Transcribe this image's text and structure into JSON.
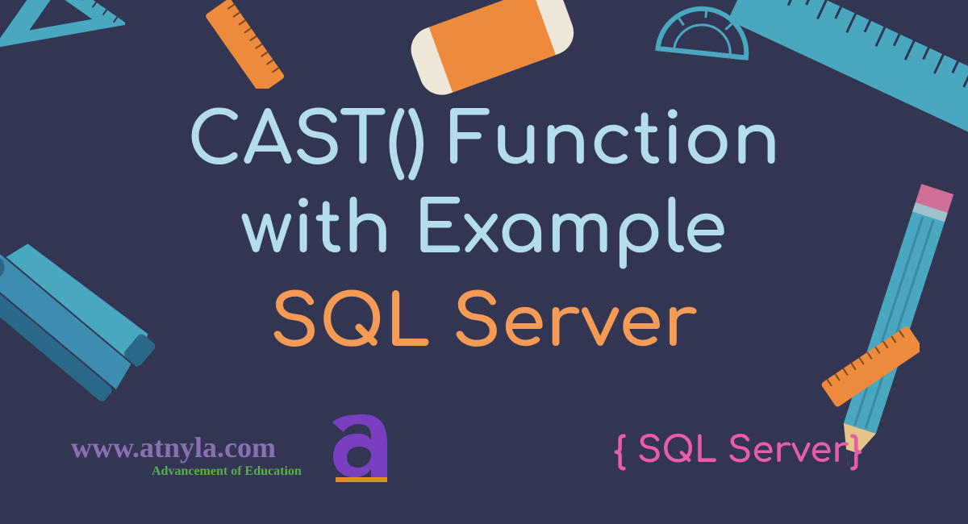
{
  "title": {
    "line1": "CAST() Function",
    "line2": "with Example",
    "line3": "SQL Server"
  },
  "tag": "{ SQL Server}",
  "logo": {
    "url": "www.atnyla.com",
    "subtitle": "Advancement of Education"
  },
  "colors": {
    "bg": "#323652",
    "textLight": "#b3dced",
    "textOrange": "#f59b55",
    "textPink": "#e85caa",
    "logoPurple": "#8b6fb3",
    "logoGreen": "#58b14e",
    "accentTeal": "#4aa7c0",
    "accentOrange": "#ed8a3c",
    "accentCream": "#efe8d9"
  }
}
